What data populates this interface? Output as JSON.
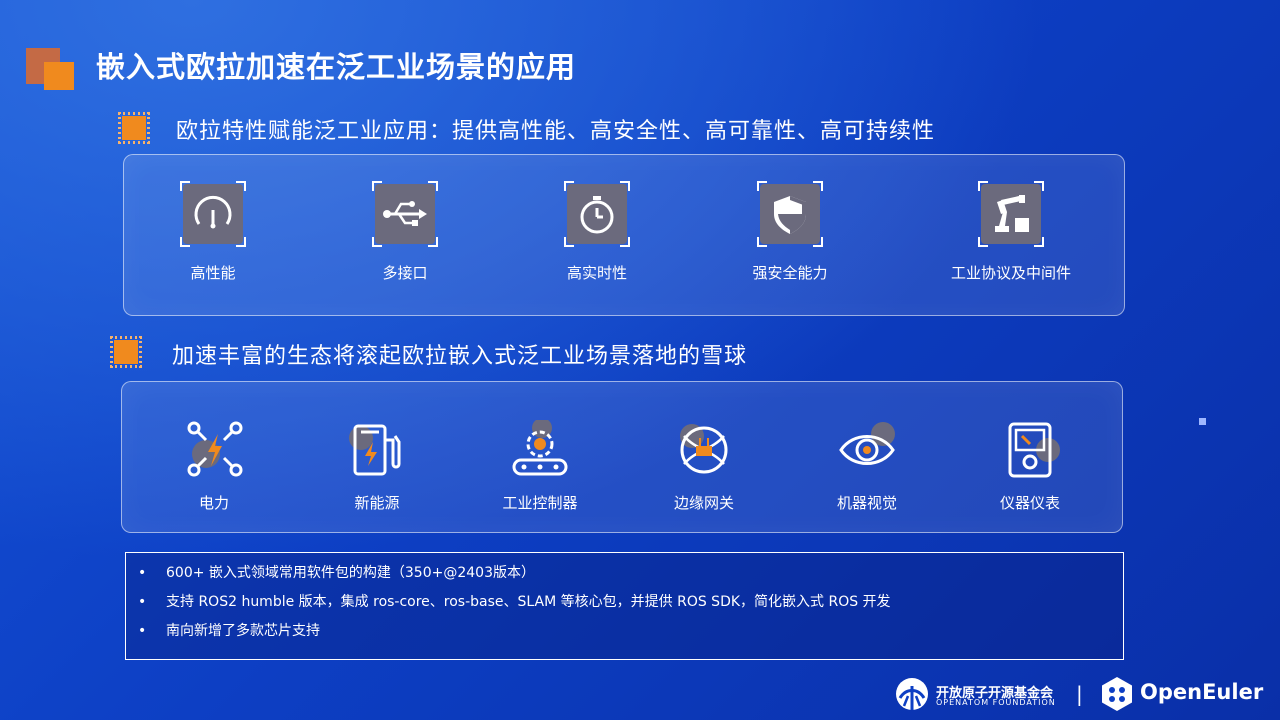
{
  "header": {
    "title": "嵌入式欧拉加速在泛工业场景的应用"
  },
  "section1": {
    "subtitle": "欧拉特性赋能泛工业应用：提供高性能、高安全性、高可靠性、高可持续性",
    "features": [
      {
        "label": "高性能",
        "icon": "gauge-icon"
      },
      {
        "label": "多接口",
        "icon": "usb-icon"
      },
      {
        "label": "高实时性",
        "icon": "stopwatch-icon"
      },
      {
        "label": "强安全能力",
        "icon": "shield-icon"
      },
      {
        "label": "工业协议及中间件",
        "icon": "robot-arm-icon"
      }
    ]
  },
  "section2": {
    "subtitle": "加速丰富的生态将滚起欧拉嵌入式泛工业场景落地的雪球",
    "items": [
      {
        "label": "电力",
        "icon": "power-bolt-icon"
      },
      {
        "label": "新能源",
        "icon": "charging-station-icon"
      },
      {
        "label": "工业控制器",
        "icon": "gear-conveyor-icon"
      },
      {
        "label": "边缘网关",
        "icon": "gateway-icon"
      },
      {
        "label": "机器视觉",
        "icon": "eye-icon"
      },
      {
        "label": "仪器仪表",
        "icon": "meter-icon"
      }
    ]
  },
  "notes": [
    "600+ 嵌入式领域常用软件包的构建（350+@2403版本）",
    "支持 ROS2 humble 版本，集成 ros-core、ros-base、SLAM 等核心包，并提供 ROS SDK，简化嵌入式 ROS 开发",
    "南向新增了多款芯片支持"
  ],
  "footer": {
    "foundation_cn": "开放原子开源基金会",
    "foundation_en": "OPENATOM FOUNDATION",
    "brand": "OpenEuler",
    "separator": "|"
  },
  "colors": {
    "accent_orange": "#f08a1e",
    "icon_gray": "#6b6a7d",
    "bg_blue": "#0d3fc4"
  }
}
